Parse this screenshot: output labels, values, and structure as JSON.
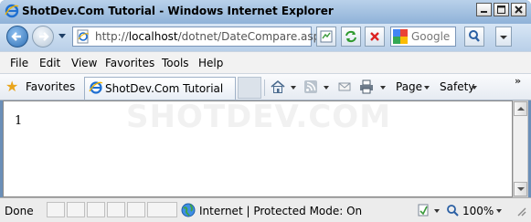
{
  "window": {
    "title": "ShotDev.Com Tutorial - Windows Internet Explorer"
  },
  "navigation": {
    "address_url_prefix": "http://",
    "address_url_host": "localhost",
    "address_url_path": "/dotnet/DateCompare.aspx",
    "search_placeholder": "Google"
  },
  "menu": {
    "items": [
      "File",
      "Edit",
      "View",
      "Favorites",
      "Tools",
      "Help"
    ]
  },
  "favorites_bar": {
    "favorites_label": "Favorites",
    "tab_title": "ShotDev.Com Tutorial",
    "page_label": "Page",
    "safety_label": "Safety",
    "overflow": "»"
  },
  "content": {
    "watermark": "SHOTDEV.COM",
    "output_text": "1"
  },
  "status": {
    "left_text": "Done",
    "zone_text": "Internet | Protected Mode: On",
    "zoom_text": "100%"
  },
  "colors": {
    "ie_blue": "#1e6fd1",
    "titlebar_top": "#b9d1ea",
    "navbar": "#c8daee"
  }
}
